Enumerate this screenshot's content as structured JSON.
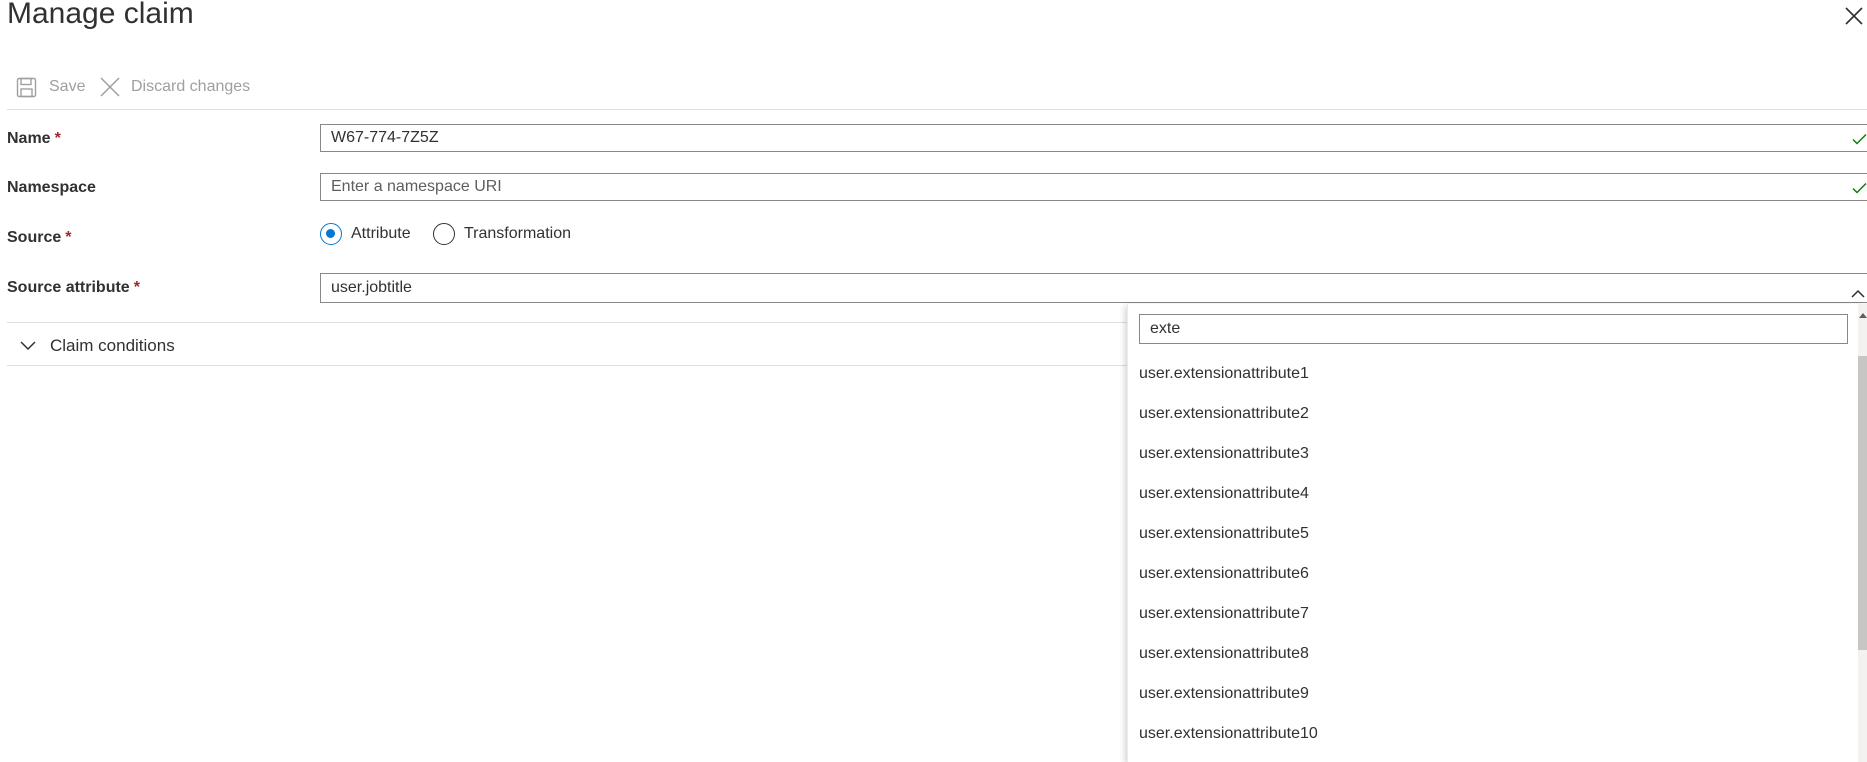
{
  "panel": {
    "title": "Manage claim",
    "close_icon": "close-icon"
  },
  "toolbar": {
    "save_label": "Save",
    "save_icon": "save-icon",
    "discard_label": "Discard changes",
    "discard_icon": "close-icon"
  },
  "form": {
    "name": {
      "label": "Name",
      "required": "*",
      "value": "W67-774-7Z5Z",
      "valid_icon": "checkmark-icon"
    },
    "namespace": {
      "label": "Namespace",
      "value": "",
      "placeholder": "Enter a namespace URI",
      "valid_icon": "checkmark-icon"
    },
    "source": {
      "label": "Source",
      "required": "*",
      "options": [
        {
          "label": "Attribute",
          "checked": true
        },
        {
          "label": "Transformation",
          "checked": false
        }
      ]
    },
    "source_attribute": {
      "label": "Source attribute",
      "required": "*",
      "value": "user.jobtitle",
      "expanded": true,
      "caret_icon": "chevron-up-icon"
    }
  },
  "claim_conditions": {
    "label": "Claim conditions",
    "collapsed": true,
    "chevron_icon": "chevron-down-icon"
  },
  "dropdown": {
    "search_value": "exte",
    "items": [
      "user.extensionattribute1",
      "user.extensionattribute2",
      "user.extensionattribute3",
      "user.extensionattribute4",
      "user.extensionattribute5",
      "user.extensionattribute6",
      "user.extensionattribute7",
      "user.extensionattribute8",
      "user.extensionattribute9",
      "user.extensionattribute10"
    ]
  },
  "colors": {
    "accent": "#0078d4",
    "required": "#a4262c",
    "valid": "#107c10",
    "disabled_text": "#a19f9d"
  }
}
